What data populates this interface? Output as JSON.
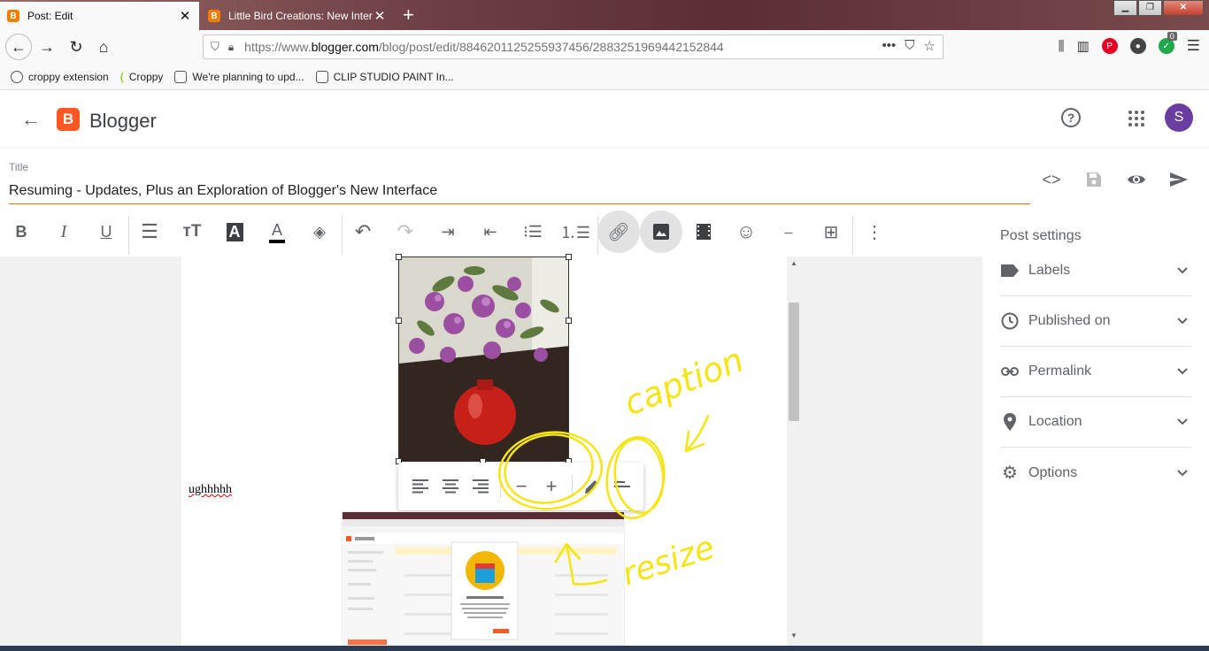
{
  "browser": {
    "tabs": [
      {
        "title": "Post: Edit",
        "favicon": "B"
      },
      {
        "title": "Little Bird Creations: New Interf",
        "favicon": "B"
      }
    ],
    "url_prefix": "https://www.",
    "url_domain": "blogger.com",
    "url_path": "/blog/post/edit/8846201125255937456/2883251969442152844",
    "bookmarks": [
      "croppy extension",
      "Croppy",
      "We're planning to upd...",
      "CLIP STUDIO PAINT In..."
    ],
    "badge_count": "0"
  },
  "header": {
    "brand": "Blogger",
    "logo_letter": "B",
    "avatar_letter": "S"
  },
  "post": {
    "title_label": "Title",
    "title": "Resuming - Updates, Plus an Exploration of Blogger's New Interface",
    "body_text": "ughhhhh"
  },
  "toolbar": {
    "bold": "B",
    "italic": "I",
    "underline": "U",
    "text_color": "A",
    "highlight": "A"
  },
  "settings": {
    "title": "Post settings",
    "items": [
      "Labels",
      "Published on",
      "Permalink",
      "Location",
      "Options"
    ]
  },
  "annotations": {
    "caption": "caption",
    "resize": "resize",
    "color": "#f5e514"
  },
  "colors": {
    "accent": "#e37400",
    "blogger_orange": "#ff5722",
    "avatar": "#6a3ea1"
  }
}
